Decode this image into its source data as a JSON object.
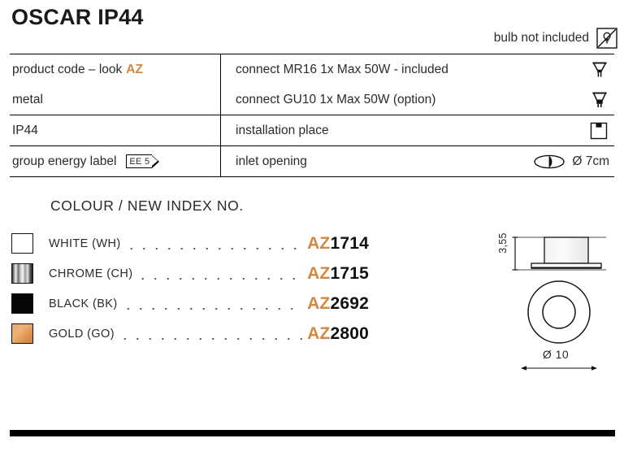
{
  "header": {
    "title": "OSCAR IP44",
    "bulb_note": "bulb not included",
    "bulb_icon": "bulb-crossed-out-icon"
  },
  "accent_color": "#D4883F",
  "spec_table": {
    "rows": [
      {
        "left_label": "product code – look",
        "left_accent": "AZ",
        "right_label": "connect MR16 1x Max 50W - included",
        "right_icon": "mr16-bulb-icon",
        "divider_top": false
      },
      {
        "left_label": "metal",
        "left_accent": "",
        "right_label": "connect GU10 1x Max 50W (option)",
        "right_icon": "gu10-bulb-icon",
        "divider_top": false
      },
      {
        "left_label": "IP44",
        "left_accent": "",
        "right_label": "installation place",
        "right_icon": "ceiling-mount-icon",
        "divider_top": true
      },
      {
        "left_label": "group energy label",
        "left_badge": "EE 5",
        "left_accent": "",
        "right_label": "inlet opening",
        "right_icon": "inlet-opening-icon",
        "right_value": "Ø 7cm",
        "divider_top": true
      }
    ]
  },
  "colour_section": {
    "heading": "COLOUR / NEW INDEX NO.",
    "items": [
      {
        "name": "WHITE (WH)",
        "swatch": "white-swatch",
        "prefix": "AZ",
        "number": "1714"
      },
      {
        "name": "CHROME (CH)",
        "swatch": "chrome-swatch",
        "prefix": "AZ",
        "number": "1715"
      },
      {
        "name": "BLACK (BK)",
        "swatch": "black-swatch",
        "prefix": "AZ",
        "number": "2692"
      },
      {
        "name": "GOLD (GO)",
        "swatch": "gold-swatch",
        "prefix": "AZ",
        "number": "2800"
      }
    ]
  },
  "technical_drawing": {
    "height_dimension": "3,55",
    "diameter_dimension": "Ø 10",
    "side_view_icon": "fixture-side-view",
    "top_view_icon": "fixture-top-view"
  }
}
